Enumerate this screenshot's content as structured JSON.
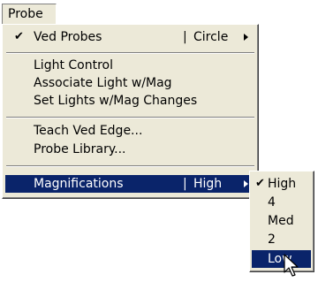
{
  "menubar": {
    "title": "Probe"
  },
  "menu": {
    "items": [
      {
        "label": "Ved Probes",
        "checked": true,
        "checkmark": "✔",
        "separator": "|",
        "value": "Circle",
        "has_submenu": true
      },
      {
        "label": "Light Control"
      },
      {
        "label": "Associate Light w/Mag"
      },
      {
        "label": "Set Lights w/Mag Changes"
      },
      {
        "label": "Teach Ved Edge..."
      },
      {
        "label": "Probe Library..."
      },
      {
        "label": "Magnifications",
        "separator": "|",
        "value": "High",
        "has_submenu": true,
        "highlighted": true
      }
    ]
  },
  "submenu": {
    "items": [
      {
        "label": "High",
        "checked": true,
        "checkmark": "✔"
      },
      {
        "label": "4"
      },
      {
        "label": "Med"
      },
      {
        "label": "2"
      },
      {
        "label": "Low",
        "highlighted": true
      }
    ]
  },
  "colors": {
    "menu_bg": "#ece9d8",
    "highlight_bg": "#0a246a",
    "highlight_text": "#ffffff"
  },
  "icons": {
    "checkmark": "check-icon",
    "submenu_arrow": "chevron-right-icon",
    "cursor": "mouse-pointer-icon"
  }
}
